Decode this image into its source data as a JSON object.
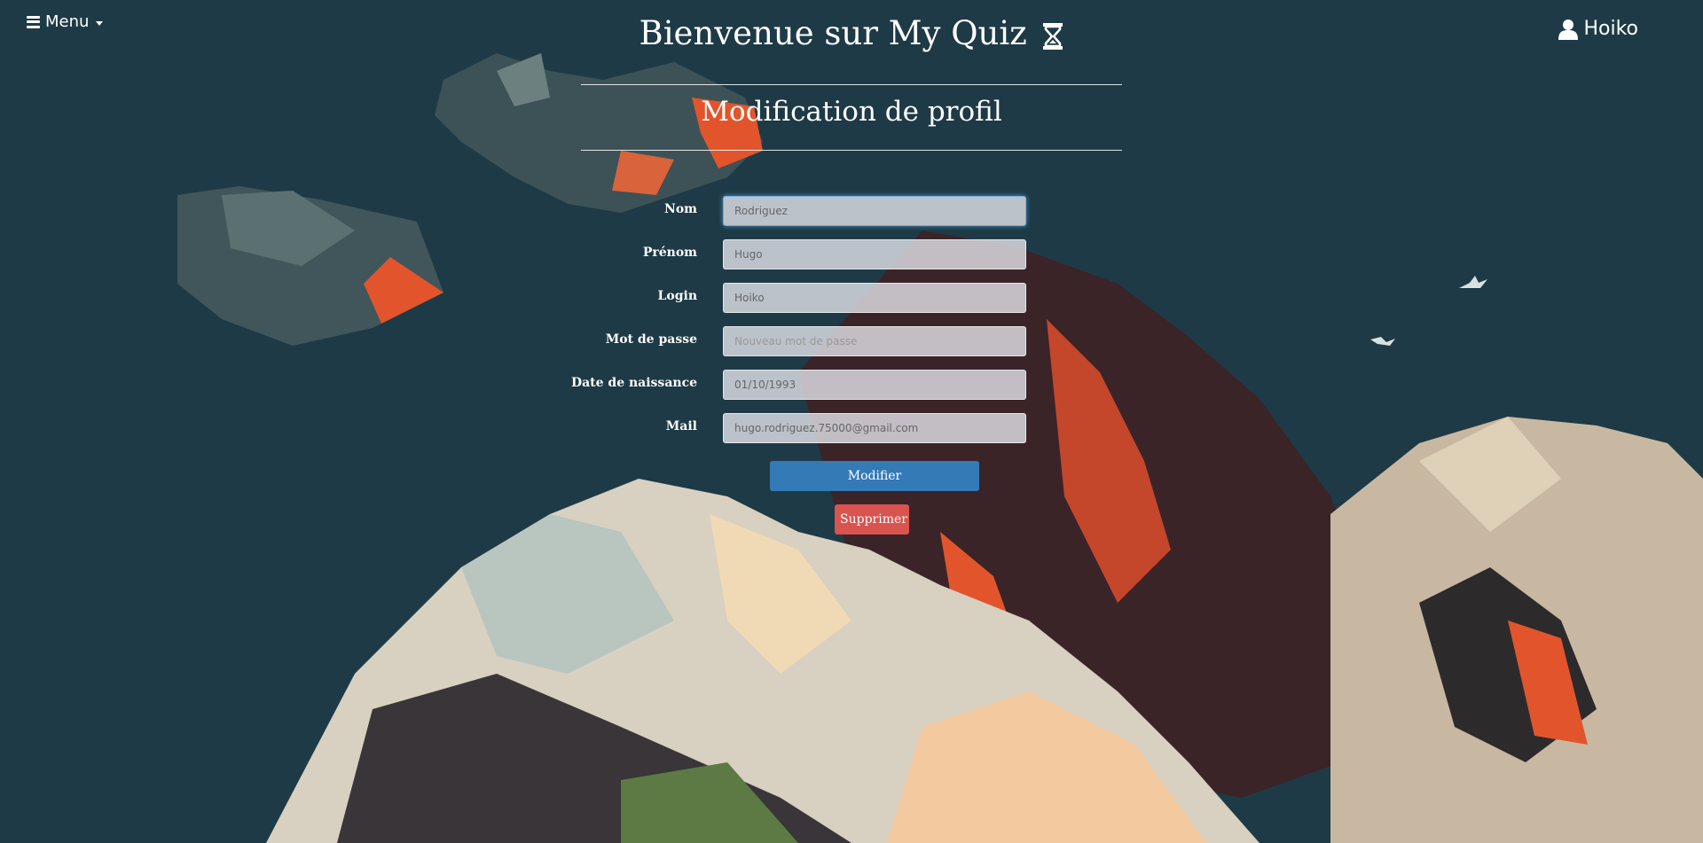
{
  "header": {
    "menu_label": "Menu",
    "title": "Bienvenue sur My Quiz",
    "username": "Hoiko"
  },
  "page": {
    "subtitle": "Modification de profil"
  },
  "form": {
    "fields": [
      {
        "label": "Nom",
        "value": "Rodriguez",
        "placeholder": ""
      },
      {
        "label": "Prénom",
        "value": "Hugo",
        "placeholder": ""
      },
      {
        "label": "Login",
        "value": "Hoiko",
        "placeholder": ""
      },
      {
        "label": "Mot de passe",
        "value": "",
        "placeholder": "Nouveau mot de passe"
      },
      {
        "label": "Date de naissance",
        "value": "01/10/1993",
        "placeholder": ""
      },
      {
        "label": "Mail",
        "value": "hugo.rodriguez.75000@gmail.com",
        "placeholder": ""
      }
    ],
    "submit_label": "Modifier",
    "delete_label": "Supprimer"
  },
  "colors": {
    "background": "#1e3a46",
    "primary_button": "#337ab7",
    "danger_button": "#d9534f",
    "text": "#ffffff"
  },
  "icons": {
    "menu": "hamburger-icon",
    "title": "hourglass-icon",
    "user": "user-icon"
  }
}
